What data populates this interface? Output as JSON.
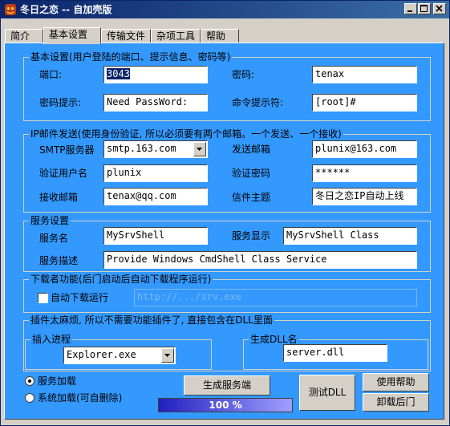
{
  "window": {
    "title": "冬日之恋 -- 自加壳版"
  },
  "tabs": [
    "简介",
    "基本设置",
    "传输文件",
    "杂项工具",
    "帮助"
  ],
  "active_tab": "基本设置",
  "basic": {
    "legend": "基本设置(用户登陆的端口、提示信息、密码等)",
    "port_label": "端口:",
    "port_value": "3043",
    "password_label": "密码:",
    "password_value": "tenax",
    "pwd_hint_label": "密码提示:",
    "pwd_hint_value": "Need PassWord:",
    "cmd_prompt_label": "命令提示符:",
    "cmd_prompt_value": "[root]#"
  },
  "mail": {
    "legend": "IP邮件发送(使用身份验证, 所以必须要有两个邮箱。一个发送、一个接收)",
    "smtp_label": "SMTP服务器",
    "smtp_value": "smtp.163.com",
    "sender_label": "发送邮箱",
    "sender_value": "plunix@163.com",
    "auth_user_label": "验证用户名",
    "auth_user_value": "plunix",
    "auth_pwd_label": "验证密码",
    "auth_pwd_value": "******",
    "receiver_label": "接收邮箱",
    "receiver_value": "tenax@qq.com",
    "subject_label": "信件主题",
    "subject_value": "冬日之恋IP自动上线"
  },
  "service": {
    "legend": "服务设置",
    "name_label": "服务名",
    "name_value": "MySrvShell",
    "display_label": "服务显示",
    "display_value": "MySrvShell Class",
    "desc_label": "服务描述",
    "desc_value": "Provide Windows CmdShell Class Service"
  },
  "downloader": {
    "legend": "下载者功能(后门启动后自动下载程序运行)",
    "auto_label": "自动下载运行",
    "auto_checked": false,
    "url_value": "http://.../srv.exe"
  },
  "plugin": {
    "note": "插件太麻烦, 所以不需要功能插件了, 直接包含在DLL里面",
    "inject_legend": "插入进程",
    "inject_value": "Explorer.exe",
    "dll_legend": "生成DLL名",
    "dll_value": "server.dll"
  },
  "load_mode": {
    "service_label": "服务加载",
    "system_label": "系统加载(可自删除)",
    "selected": "service"
  },
  "buttons": {
    "generate": "生成服务端",
    "test_dll": "测试DLL",
    "help": "使用帮助",
    "uninstall": "卸载后门"
  },
  "progress": {
    "value": 100,
    "text": "100 %"
  },
  "colors": {
    "panel": "#3399ff",
    "titlebar": "#0a246a",
    "progress_fill": "#2020c0"
  }
}
